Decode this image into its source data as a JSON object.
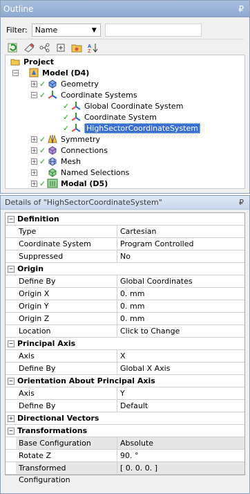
{
  "outline": {
    "title": "Outline",
    "pin": "₽",
    "filter_label": "Filter:",
    "filter_value": "Name",
    "filter_arrow": "▼",
    "filter_text": "",
    "toolbar_icons": [
      "refresh-icon",
      "select-icon",
      "graph-icon",
      "expand-all-icon",
      "folder-icon",
      "sort-icon"
    ],
    "tree": [
      {
        "label": "Project",
        "depth": 0,
        "icon": "project-icon",
        "bold": true
      },
      {
        "label": "Model (D4)",
        "depth": 1,
        "icon": "model-icon",
        "bold": true,
        "expander": "−"
      },
      {
        "label": "Geometry",
        "depth": 2,
        "icon": "geometry-icon",
        "expander": "+",
        "check": true
      },
      {
        "label": "Coordinate Systems",
        "depth": 2,
        "icon": "coordinate-systems-icon",
        "expander": "−",
        "check": true
      },
      {
        "label": "Global Coordinate System",
        "depth": 3,
        "icon": "axes-icon",
        "check": true
      },
      {
        "label": "Coordinate System",
        "depth": 3,
        "icon": "axes-icon",
        "check": true
      },
      {
        "label": "HighSectorCoordinateSystem",
        "depth": 3,
        "icon": "axes-icon",
        "check": true,
        "selected": true
      },
      {
        "label": "Symmetry",
        "depth": 2,
        "icon": "symmetry-icon",
        "expander": "+",
        "check": true
      },
      {
        "label": "Connections",
        "depth": 2,
        "icon": "connections-icon",
        "expander": "+",
        "check": true
      },
      {
        "label": "Mesh",
        "depth": 2,
        "icon": "mesh-icon",
        "expander": "+",
        "check": true
      },
      {
        "label": "Named Selections",
        "depth": 2,
        "icon": "named-selections-icon",
        "expander": "+"
      },
      {
        "label": "Modal (D5)",
        "depth": 2,
        "icon": "modal-icon",
        "expander": "+",
        "check": true,
        "bold": true
      }
    ]
  },
  "details": {
    "title": "Details of \"HighSectorCoordinateSystem\"",
    "pin": "₽",
    "groups": [
      {
        "name": "Definition",
        "expander": "−",
        "rows": [
          {
            "key": "Type",
            "value": "Cartesian"
          },
          {
            "key": "Coordinate System",
            "value": "Program Controlled"
          },
          {
            "key": "Suppressed",
            "value": "No"
          }
        ]
      },
      {
        "name": "Origin",
        "expander": "−",
        "rows": [
          {
            "key": "Define By",
            "value": "Global Coordinates"
          },
          {
            "key": "Origin X",
            "value": "0. mm"
          },
          {
            "key": "Origin Y",
            "value": "0. mm"
          },
          {
            "key": "Origin Z",
            "value": "0. mm"
          },
          {
            "key": "Location",
            "value": "Click to Change"
          }
        ]
      },
      {
        "name": "Principal Axis",
        "expander": "−",
        "rows": [
          {
            "key": "Axis",
            "value": "X"
          },
          {
            "key": "Define By",
            "value": "Global X Axis"
          }
        ]
      },
      {
        "name": "Orientation About Principal Axis",
        "expander": "−",
        "rows": [
          {
            "key": "Axis",
            "value": "Y"
          },
          {
            "key": "Define By",
            "value": "Default"
          }
        ]
      },
      {
        "name": "Directional Vectors",
        "expander": "+",
        "rows": []
      },
      {
        "name": "Transformations",
        "expander": "−",
        "rows": [
          {
            "key": "Base Configuration",
            "value": "Absolute",
            "shaded": true
          },
          {
            "key": "Rotate Z",
            "value": "90. °"
          },
          {
            "key": "Transformed Configuration",
            "value": "[ 0. 0. 0. ]",
            "shaded": true
          }
        ]
      }
    ]
  }
}
